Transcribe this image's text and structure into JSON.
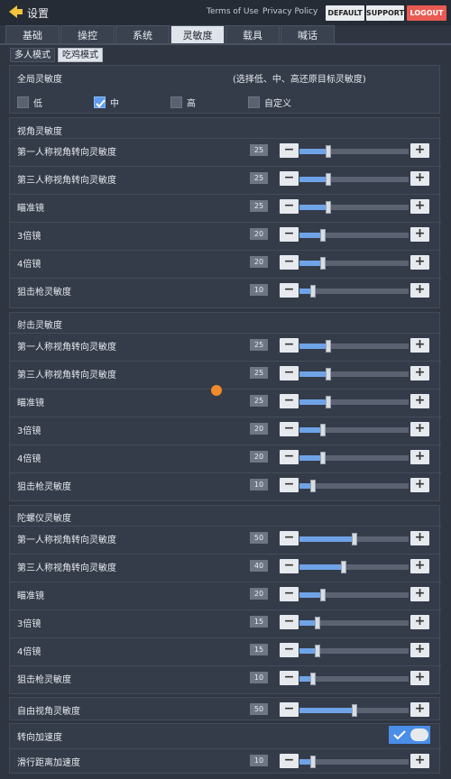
{
  "header": {
    "title": "设置",
    "terms": "Terms of Use",
    "privacy": "Privacy Policy",
    "default_btn": "DEFAULT",
    "support_btn": "SUPPORT",
    "logout_btn": "LOGOUT"
  },
  "tabs": [
    "基础",
    "操控",
    "系统",
    "灵敏度",
    "载具",
    "喊话"
  ],
  "active_tab": "灵敏度",
  "modes": [
    "多人模式",
    "吃鸡模式"
  ],
  "global": {
    "title": "全局灵敏度",
    "hint": "(选择低、中、高还原目标灵敏度)",
    "options": [
      "低",
      "中",
      "高",
      "自定义"
    ],
    "selected": "中"
  },
  "view": {
    "title": "视角灵敏度",
    "rows": [
      {
        "label": "第一人称视角转向灵敏度",
        "value": "25",
        "level": 0.25
      },
      {
        "label": "第三人称视角转向灵敏度",
        "value": "25",
        "level": 0.25
      },
      {
        "label": "瞄准镜",
        "value": "25",
        "level": 0.25
      },
      {
        "label": "3倍镜",
        "value": "20",
        "level": 0.2
      },
      {
        "label": "4倍镜",
        "value": "20",
        "level": 0.2
      },
      {
        "label": "狙击枪灵敏度",
        "value": "10",
        "level": 0.1
      }
    ]
  },
  "fire": {
    "title": "射击灵敏度",
    "rows": [
      {
        "label": "第一人称视角转向灵敏度",
        "value": "25",
        "level": 0.25
      },
      {
        "label": "第三人称视角转向灵敏度",
        "value": "25",
        "level": 0.25
      },
      {
        "label": "瞄准镜",
        "value": "25",
        "level": 0.25
      },
      {
        "label": "3倍镜",
        "value": "20",
        "level": 0.2
      },
      {
        "label": "4倍镜",
        "value": "20",
        "level": 0.2
      },
      {
        "label": "狙击枪灵敏度",
        "value": "10",
        "level": 0.1
      }
    ]
  },
  "gyro": {
    "title": "陀螺仪灵敏度",
    "rows": [
      {
        "label": "第一人称视角转向灵敏度",
        "value": "50",
        "level": 0.5
      },
      {
        "label": "第三人称视角转向灵敏度",
        "value": "40",
        "level": 0.4
      },
      {
        "label": "瞄准镜",
        "value": "20",
        "level": 0.2
      },
      {
        "label": "3倍镜",
        "value": "15",
        "level": 0.15
      },
      {
        "label": "4倍镜",
        "value": "15",
        "level": 0.15
      },
      {
        "label": "狙击枪灵敏度",
        "value": "10",
        "level": 0.1
      }
    ]
  },
  "free_look": {
    "label": "自由视角灵敏度",
    "value": "50",
    "level": 0.5
  },
  "turn_accel": {
    "label": "转向加速度",
    "enabled": true
  },
  "slide_accel": {
    "label": "滑行距离加速度",
    "value": "10",
    "level": 0.1
  },
  "colors": {
    "accent": "#6fa3e8",
    "logout": "#e85a52"
  },
  "icons": {
    "back": "back-arrow-icon",
    "check": "check-icon",
    "watermark": "watermark-logo-icon"
  }
}
